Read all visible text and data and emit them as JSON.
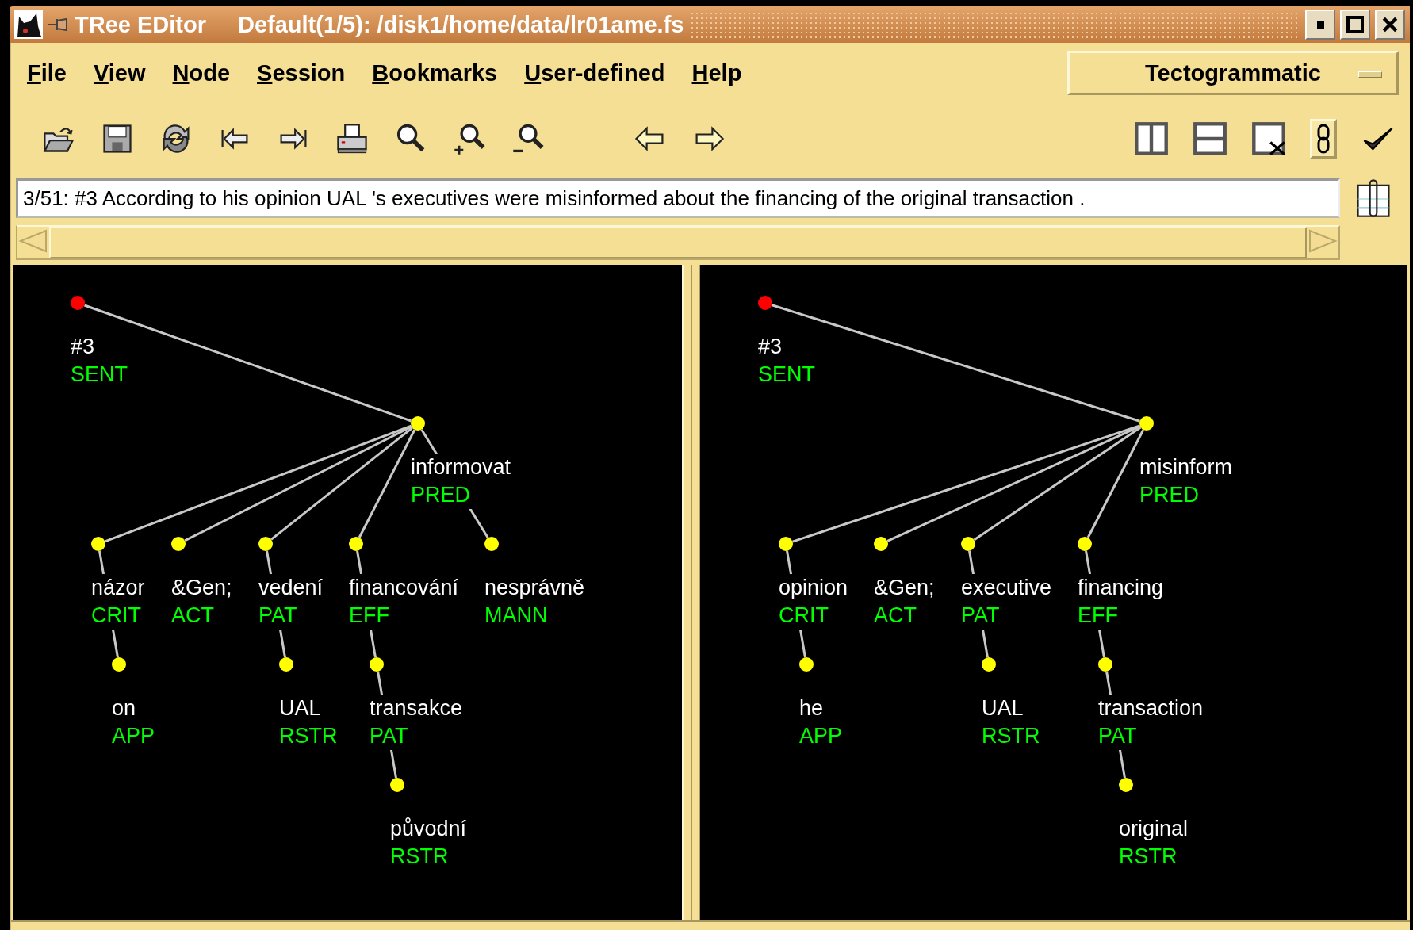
{
  "window": {
    "title": "TRee EDitor",
    "document": "Default(1/5): /disk1/home/data/lr01ame.fs"
  },
  "menu": [
    {
      "label": "File"
    },
    {
      "label": "View"
    },
    {
      "label": "Node"
    },
    {
      "label": "Session"
    },
    {
      "label": "Bookmarks"
    },
    {
      "label": "User-defined"
    },
    {
      "label": "Help"
    }
  ],
  "mode_selector": {
    "value": "Tectogrammatic"
  },
  "toolbar": {
    "link_on": true
  },
  "sentence_field": {
    "value": "3/51: #3 According to his opinion UAL 's executives were misinformed about the financing of the original transaction ."
  },
  "trees": [
    {
      "root": {
        "word": "#3",
        "functor": "SENT",
        "color": "#ff0000",
        "children": [
          {
            "word": "informovat",
            "functor": "PRED",
            "color": "#ffff00",
            "after_parent": true,
            "children": [
              {
                "word": "názor",
                "functor": "CRIT",
                "color": "#ffff00",
                "after_parent": false,
                "children": [
                  {
                    "word": "on",
                    "functor": "APP",
                    "color": "#ffff00",
                    "after_parent": true
                  }
                ]
              },
              {
                "word": "&Gen;",
                "functor": "ACT",
                "color": "#ffff00",
                "after_parent": false
              },
              {
                "word": "vedení",
                "functor": "PAT",
                "color": "#ffff00",
                "after_parent": false,
                "children": [
                  {
                    "word": "UAL",
                    "functor": "RSTR",
                    "color": "#ffff00",
                    "after_parent": true
                  }
                ]
              },
              {
                "word": "financování",
                "functor": "EFF",
                "color": "#ffff00",
                "after_parent": false,
                "children": [
                  {
                    "word": "transakce",
                    "functor": "PAT",
                    "color": "#ffff00",
                    "after_parent": true,
                    "children": [
                      {
                        "word": "původní",
                        "functor": "RSTR",
                        "color": "#ffff00",
                        "after_parent": true
                      }
                    ]
                  }
                ]
              },
              {
                "word": "nesprávně",
                "functor": "MANN",
                "color": "#ffff00",
                "after_parent": true
              }
            ]
          }
        ]
      }
    },
    {
      "root": {
        "word": "#3",
        "functor": "SENT",
        "color": "#ff0000",
        "children": [
          {
            "word": "misinform",
            "functor": "PRED",
            "color": "#ffff00",
            "after_parent": true,
            "children": [
              {
                "word": "opinion",
                "functor": "CRIT",
                "color": "#ffff00",
                "after_parent": false,
                "children": [
                  {
                    "word": "he",
                    "functor": "APP",
                    "color": "#ffff00",
                    "after_parent": true
                  }
                ]
              },
              {
                "word": "&Gen;",
                "functor": "ACT",
                "color": "#ffff00",
                "after_parent": false
              },
              {
                "word": "executive",
                "functor": "PAT",
                "color": "#ffff00",
                "after_parent": false,
                "children": [
                  {
                    "word": "UAL",
                    "functor": "RSTR",
                    "color": "#ffff00",
                    "after_parent": true
                  }
                ]
              },
              {
                "word": "financing",
                "functor": "EFF",
                "color": "#ffff00",
                "after_parent": false,
                "children": [
                  {
                    "word": "transaction",
                    "functor": "PAT",
                    "color": "#ffff00",
                    "after_parent": true,
                    "children": [
                      {
                        "word": "original",
                        "functor": "RSTR",
                        "color": "#ffff00",
                        "after_parent": true
                      }
                    ]
                  }
                ]
              }
            ]
          }
        ]
      }
    }
  ]
}
